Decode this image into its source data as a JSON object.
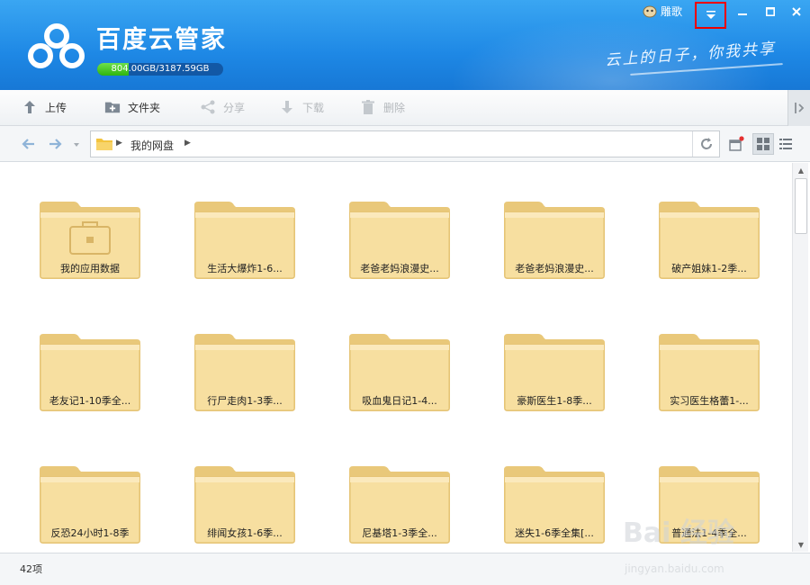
{
  "window": {
    "app_title": "百度云管家",
    "quota_text": "804.00GB/3187.59GB",
    "quota_fraction": 0.252,
    "slogan": "云上的日子，你我共享",
    "username": "雕歌",
    "menu_icon": "dropdown-triangle-icon",
    "minimize_icon": "minimize-icon",
    "maximize_icon": "maximize-icon",
    "close_icon": "close-icon"
  },
  "toolbar": {
    "upload": "上传",
    "new_folder": "文件夹",
    "share": "分享",
    "download": "下载",
    "delete": "删除"
  },
  "nav": {
    "breadcrumb": "我的网盘"
  },
  "files": [
    {
      "name": "我的应用数据",
      "special": true
    },
    {
      "name": "生活大爆炸1-6..."
    },
    {
      "name": "老爸老妈浪漫史..."
    },
    {
      "name": "老爸老妈浪漫史..."
    },
    {
      "name": "破产姐妹1-2季..."
    },
    {
      "name": "老友记1-10季全..."
    },
    {
      "name": "行尸走肉1-3季..."
    },
    {
      "name": "吸血鬼日记1-4..."
    },
    {
      "name": "豪斯医生1-8季..."
    },
    {
      "name": "实习医生格蕾1-..."
    },
    {
      "name": "反恐24小时1-8季"
    },
    {
      "name": "绯闻女孩1-6季..."
    },
    {
      "name": "尼基塔1-3季全..."
    },
    {
      "name": "迷失1-6季全集[..."
    },
    {
      "name": "普通法1-4季全..."
    }
  ],
  "status": {
    "count": "42项"
  },
  "watermark": {
    "text": "Bai 经验",
    "url": "jingyan.baidu.com"
  }
}
